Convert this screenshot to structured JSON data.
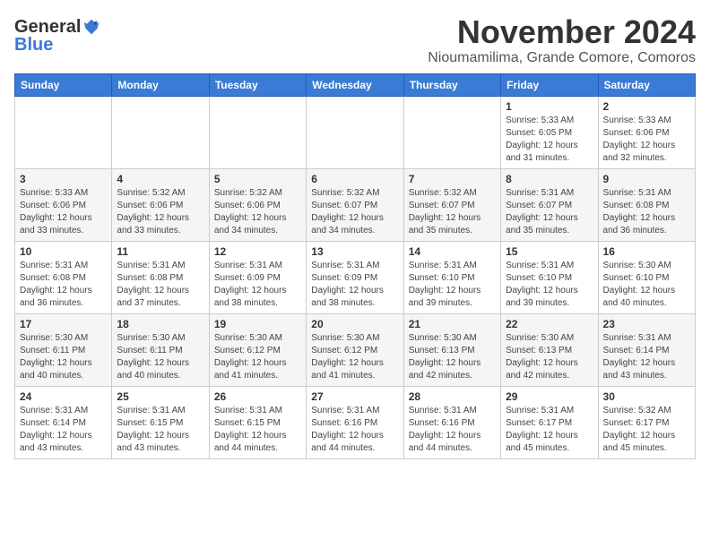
{
  "logo": {
    "general": "General",
    "blue": "Blue"
  },
  "title": {
    "month": "November 2024",
    "location": "Nioumamilima, Grande Comore, Comoros"
  },
  "headers": [
    "Sunday",
    "Monday",
    "Tuesday",
    "Wednesday",
    "Thursday",
    "Friday",
    "Saturday"
  ],
  "weeks": [
    [
      {
        "day": "",
        "info": ""
      },
      {
        "day": "",
        "info": ""
      },
      {
        "day": "",
        "info": ""
      },
      {
        "day": "",
        "info": ""
      },
      {
        "day": "",
        "info": ""
      },
      {
        "day": "1",
        "info": "Sunrise: 5:33 AM\nSunset: 6:05 PM\nDaylight: 12 hours and 31 minutes."
      },
      {
        "day": "2",
        "info": "Sunrise: 5:33 AM\nSunset: 6:06 PM\nDaylight: 12 hours and 32 minutes."
      }
    ],
    [
      {
        "day": "3",
        "info": "Sunrise: 5:33 AM\nSunset: 6:06 PM\nDaylight: 12 hours and 33 minutes."
      },
      {
        "day": "4",
        "info": "Sunrise: 5:32 AM\nSunset: 6:06 PM\nDaylight: 12 hours and 33 minutes."
      },
      {
        "day": "5",
        "info": "Sunrise: 5:32 AM\nSunset: 6:06 PM\nDaylight: 12 hours and 34 minutes."
      },
      {
        "day": "6",
        "info": "Sunrise: 5:32 AM\nSunset: 6:07 PM\nDaylight: 12 hours and 34 minutes."
      },
      {
        "day": "7",
        "info": "Sunrise: 5:32 AM\nSunset: 6:07 PM\nDaylight: 12 hours and 35 minutes."
      },
      {
        "day": "8",
        "info": "Sunrise: 5:31 AM\nSunset: 6:07 PM\nDaylight: 12 hours and 35 minutes."
      },
      {
        "day": "9",
        "info": "Sunrise: 5:31 AM\nSunset: 6:08 PM\nDaylight: 12 hours and 36 minutes."
      }
    ],
    [
      {
        "day": "10",
        "info": "Sunrise: 5:31 AM\nSunset: 6:08 PM\nDaylight: 12 hours and 36 minutes."
      },
      {
        "day": "11",
        "info": "Sunrise: 5:31 AM\nSunset: 6:08 PM\nDaylight: 12 hours and 37 minutes."
      },
      {
        "day": "12",
        "info": "Sunrise: 5:31 AM\nSunset: 6:09 PM\nDaylight: 12 hours and 38 minutes."
      },
      {
        "day": "13",
        "info": "Sunrise: 5:31 AM\nSunset: 6:09 PM\nDaylight: 12 hours and 38 minutes."
      },
      {
        "day": "14",
        "info": "Sunrise: 5:31 AM\nSunset: 6:10 PM\nDaylight: 12 hours and 39 minutes."
      },
      {
        "day": "15",
        "info": "Sunrise: 5:31 AM\nSunset: 6:10 PM\nDaylight: 12 hours and 39 minutes."
      },
      {
        "day": "16",
        "info": "Sunrise: 5:30 AM\nSunset: 6:10 PM\nDaylight: 12 hours and 40 minutes."
      }
    ],
    [
      {
        "day": "17",
        "info": "Sunrise: 5:30 AM\nSunset: 6:11 PM\nDaylight: 12 hours and 40 minutes."
      },
      {
        "day": "18",
        "info": "Sunrise: 5:30 AM\nSunset: 6:11 PM\nDaylight: 12 hours and 40 minutes."
      },
      {
        "day": "19",
        "info": "Sunrise: 5:30 AM\nSunset: 6:12 PM\nDaylight: 12 hours and 41 minutes."
      },
      {
        "day": "20",
        "info": "Sunrise: 5:30 AM\nSunset: 6:12 PM\nDaylight: 12 hours and 41 minutes."
      },
      {
        "day": "21",
        "info": "Sunrise: 5:30 AM\nSunset: 6:13 PM\nDaylight: 12 hours and 42 minutes."
      },
      {
        "day": "22",
        "info": "Sunrise: 5:30 AM\nSunset: 6:13 PM\nDaylight: 12 hours and 42 minutes."
      },
      {
        "day": "23",
        "info": "Sunrise: 5:31 AM\nSunset: 6:14 PM\nDaylight: 12 hours and 43 minutes."
      }
    ],
    [
      {
        "day": "24",
        "info": "Sunrise: 5:31 AM\nSunset: 6:14 PM\nDaylight: 12 hours and 43 minutes."
      },
      {
        "day": "25",
        "info": "Sunrise: 5:31 AM\nSunset: 6:15 PM\nDaylight: 12 hours and 43 minutes."
      },
      {
        "day": "26",
        "info": "Sunrise: 5:31 AM\nSunset: 6:15 PM\nDaylight: 12 hours and 44 minutes."
      },
      {
        "day": "27",
        "info": "Sunrise: 5:31 AM\nSunset: 6:16 PM\nDaylight: 12 hours and 44 minutes."
      },
      {
        "day": "28",
        "info": "Sunrise: 5:31 AM\nSunset: 6:16 PM\nDaylight: 12 hours and 44 minutes."
      },
      {
        "day": "29",
        "info": "Sunrise: 5:31 AM\nSunset: 6:17 PM\nDaylight: 12 hours and 45 minutes."
      },
      {
        "day": "30",
        "info": "Sunrise: 5:32 AM\nSunset: 6:17 PM\nDaylight: 12 hours and 45 minutes."
      }
    ]
  ]
}
